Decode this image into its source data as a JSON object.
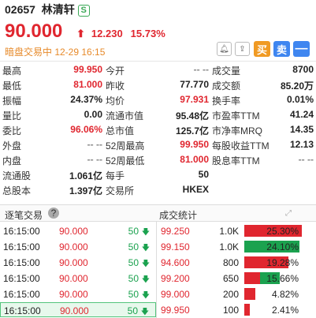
{
  "header": {
    "code": "02657",
    "name": "林清轩",
    "badge": "S",
    "price": "90.000",
    "change": "12.230",
    "change_pct": "15.73%",
    "status": "暗盘交易中 12-29 16:15",
    "buy_label": "买",
    "sell_label": "卖",
    "colors": {
      "up": "#e0262f",
      "down": "#1ba24f",
      "buy": "#f09a23",
      "sell": "#3f86f0"
    }
  },
  "quote": [
    {
      "l1": "最高",
      "v1": "99.950",
      "c1": "red",
      "l2": "今开",
      "v2": "-- --",
      "c2": "gray",
      "l3": "成交量",
      "v3": "8700",
      "c3": "dark"
    },
    {
      "l1": "最低",
      "v1": "81.000",
      "c1": "red",
      "l2": "昨收",
      "v2": "77.770",
      "c2": "dark",
      "l3": "成交额",
      "v3": "85.20万",
      "c3": "dark"
    },
    {
      "l1": "振幅",
      "v1": "24.37%",
      "c1": "dark",
      "l2": "均价",
      "v2": "97.931",
      "c2": "red",
      "l3": "换手率",
      "v3": "0.01%",
      "c3": "dark"
    },
    {
      "l1": "量比",
      "v1": "0.00",
      "c1": "dark",
      "l2": "流通市值",
      "v2": "95.48亿",
      "c2": "dark",
      "l3": "市盈率TTM",
      "v3": "41.24",
      "c3": "dark"
    },
    {
      "l1": "委比",
      "v1": "96.06%",
      "c1": "red",
      "l2": "总市值",
      "v2": "125.7亿",
      "c2": "dark",
      "l3": "市净率MRQ",
      "v3": "14.35",
      "c3": "dark"
    },
    {
      "l1": "外盘",
      "v1": "-- --",
      "c1": "gray",
      "l2": "52周最高",
      "v2": "99.950",
      "c2": "red",
      "l3": "每股收益TTM",
      "v3": "12.13",
      "c3": "dark"
    },
    {
      "l1": "内盘",
      "v1": "-- --",
      "c1": "gray",
      "l2": "52周最低",
      "v2": "81.000",
      "c2": "red",
      "l3": "股息率TTM",
      "v3": "-- --",
      "c3": "gray"
    },
    {
      "l1": "流通股",
      "v1": "1.061亿",
      "c1": "dark",
      "l2": "每手",
      "v2": "50",
      "c2": "dark",
      "l3": "",
      "v3": "",
      "c3": "dark"
    },
    {
      "l1": "总股本",
      "v1": "1.397亿",
      "c1": "dark",
      "l2": "交易所",
      "v2": "HKEX",
      "c2": "dark",
      "l3": "",
      "v3": "",
      "c3": "dark"
    }
  ],
  "ticks_title": "逐笔交易",
  "stats_title": "成交统计",
  "ticks": [
    {
      "time": "16:15:00",
      "price": "90.000",
      "vol": "50"
    },
    {
      "time": "16:15:00",
      "price": "90.000",
      "vol": "50"
    },
    {
      "time": "16:15:00",
      "price": "90.000",
      "vol": "50"
    },
    {
      "time": "16:15:00",
      "price": "90.000",
      "vol": "50"
    },
    {
      "time": "16:15:00",
      "price": "90.000",
      "vol": "50"
    },
    {
      "time": "16:15:00",
      "price": "90.000",
      "vol": "50"
    }
  ],
  "stats": [
    {
      "price": "99.250",
      "vol": "1.0K",
      "pct": "25.30%",
      "frac": 0.253,
      "buy": 1.0
    },
    {
      "price": "99.150",
      "vol": "1.0K",
      "pct": "24.10%",
      "frac": 0.241,
      "buy": 0.0
    },
    {
      "price": "94.600",
      "vol": "800",
      "pct": "19.28%",
      "frac": 0.1928,
      "buy": 1.0
    },
    {
      "price": "99.200",
      "vol": "650",
      "pct": "15.66%",
      "frac": 0.1566,
      "buy": 0.45
    },
    {
      "price": "99.000",
      "vol": "200",
      "pct": "4.82%",
      "frac": 0.0482,
      "buy": 1.0
    },
    {
      "price": "99.950",
      "vol": "100",
      "pct": "2.41%",
      "frac": 0.0241,
      "buy": 1.0
    }
  ]
}
